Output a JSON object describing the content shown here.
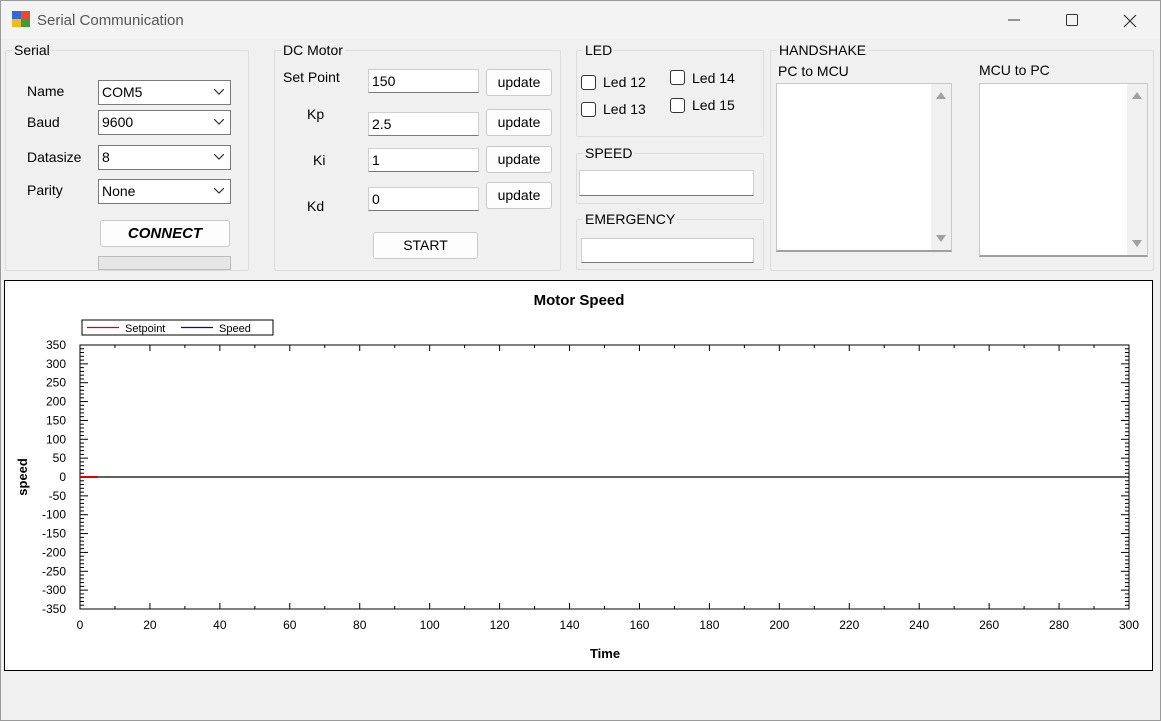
{
  "window": {
    "title": "Serial Communication"
  },
  "serial": {
    "title": "Serial",
    "name_label": "Name",
    "name_value": "COM5",
    "baud_label": "Baud",
    "baud_value": "9600",
    "datasize_label": "Datasize",
    "datasize_value": "8",
    "parity_label": "Parity",
    "parity_value": "None",
    "connect_label": "CONNECT",
    "progress": 0
  },
  "dc_motor": {
    "title": "DC Motor",
    "setpoint_label": "Set Point",
    "setpoint_value": "150",
    "kp_label": "Kp",
    "kp_value": "2.5",
    "ki_label": "Ki",
    "ki_value": "1",
    "kd_label": "Kd",
    "kd_value": "0",
    "update_label": "update",
    "start_label": "START"
  },
  "led": {
    "title": "LED",
    "items": [
      {
        "label": "Led 12",
        "checked": false
      },
      {
        "label": "Led 13",
        "checked": false
      },
      {
        "label": "Led 14",
        "checked": false
      },
      {
        "label": "Led 15",
        "checked": false
      }
    ]
  },
  "speed": {
    "title": "SPEED",
    "value": ""
  },
  "emergency": {
    "title": "EMERGENCY",
    "value": ""
  },
  "handshake": {
    "title": "HANDSHAKE",
    "pc_to_mcu_label": "PC to MCU",
    "mcu_to_pc_label": "MCU to PC"
  },
  "colors": {
    "setpoint": "#e00000",
    "speed": "#0000e0"
  },
  "chart_data": {
    "type": "line",
    "title": "Motor Speed",
    "xlabel": "Time",
    "ylabel": "speed",
    "xlim": [
      0,
      300
    ],
    "ylim": [
      -350,
      350
    ],
    "x_ticks": [
      "0",
      "20",
      "40",
      "60",
      "80",
      "100",
      "120",
      "140",
      "160",
      "180",
      "200",
      "220",
      "240",
      "260",
      "280",
      "300"
    ],
    "y_ticks": [
      "350",
      "300",
      "250",
      "200",
      "150",
      "100",
      "50",
      "0",
      "-50",
      "-100",
      "-150",
      "-200",
      "-250",
      "-300",
      "-350"
    ],
    "legend_position": "top-left",
    "series": [
      {
        "name": "Setpoint",
        "x": [
          0,
          5
        ],
        "y": [
          0,
          0
        ]
      },
      {
        "name": "Speed",
        "x": [],
        "y": []
      }
    ]
  }
}
